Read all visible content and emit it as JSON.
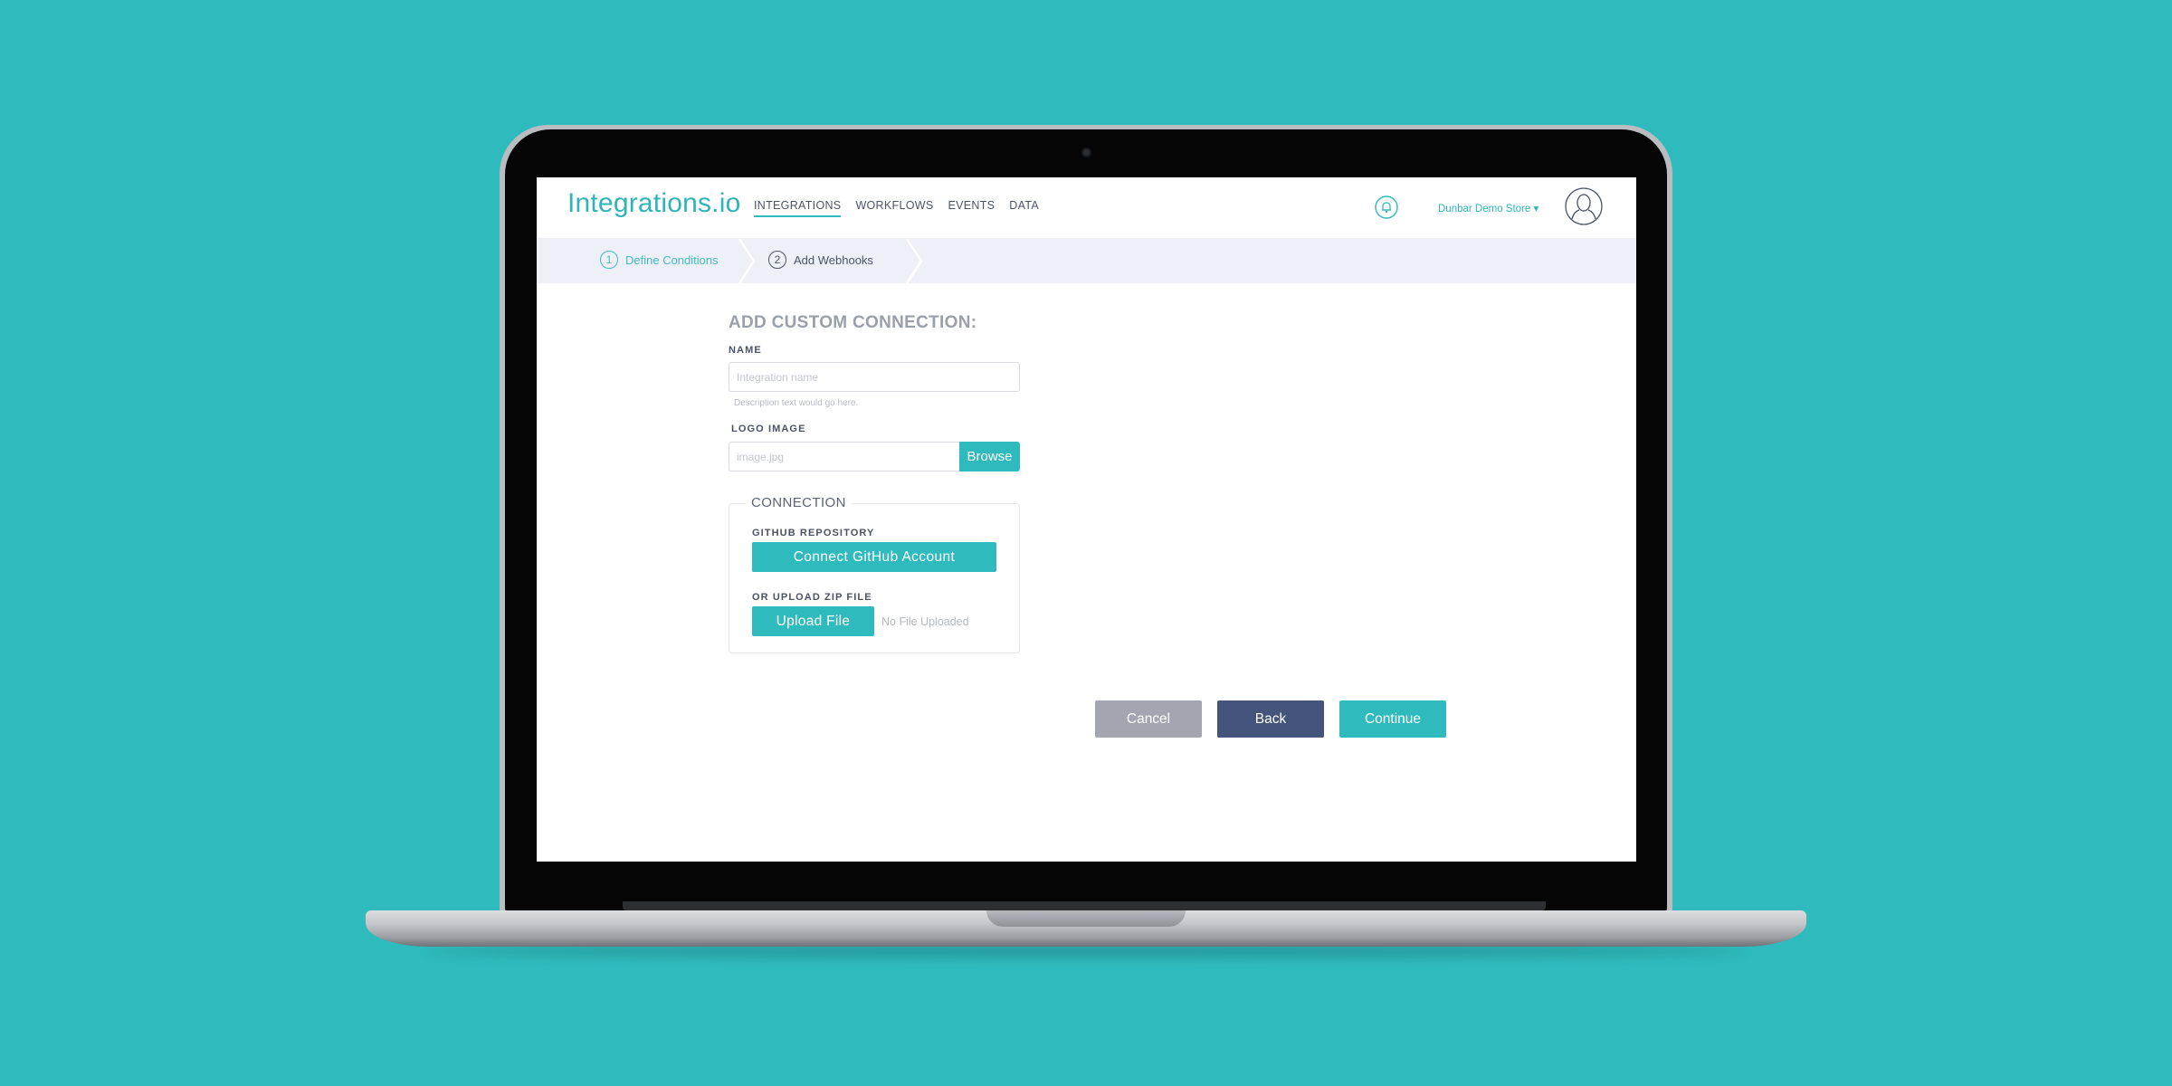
{
  "app": {
    "logo": "Integrations.io"
  },
  "nav": {
    "links": [
      {
        "label": "INTEGRATIONS",
        "active": true
      },
      {
        "label": "WORKFLOWS",
        "active": false
      },
      {
        "label": "EVENTS",
        "active": false
      },
      {
        "label": "DATA",
        "active": false
      }
    ],
    "store_label": "Dunbar Demo Store ▾",
    "bell_icon": "bell-icon",
    "avatar_icon": "user-avatar-icon"
  },
  "steps": [
    {
      "number": "1",
      "label": "Define Conditions",
      "active": true
    },
    {
      "number": "2",
      "label": "Add Webhooks",
      "active": false
    }
  ],
  "form": {
    "title": "ADD CUSTOM CONNECTION:",
    "name_label": "NAME",
    "name_placeholder": "Integration name",
    "name_value": "",
    "name_helper": "Description text would go here.",
    "logo_label": "LOGO IMAGE",
    "logo_placeholder": "image.jpg",
    "logo_value": "",
    "browse_label": "Browse",
    "connection": {
      "legend": "CONNECTION",
      "github_label": "GITHUB REPOSITORY",
      "github_button": "Connect GitHub Account",
      "zip_label": "OR UPLOAD ZIP FILE",
      "upload_button": "Upload File",
      "upload_status": "No File Uploaded"
    }
  },
  "actions": {
    "cancel": "Cancel",
    "back": "Back",
    "continue": "Continue"
  },
  "colors": {
    "background": "#2fbbbe",
    "accent": "#2fbbbe",
    "back_button": "#44547a",
    "cancel_button": "#a3a6b0",
    "stepbar": "#eef0f8"
  }
}
